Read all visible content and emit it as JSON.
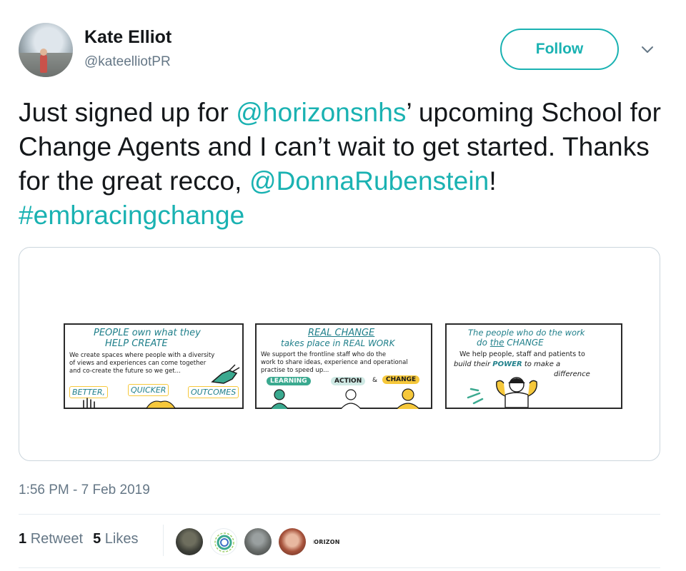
{
  "user": {
    "display_name": "Kate Elliot",
    "handle": "@kateelliotPR"
  },
  "actions": {
    "follow_label": "Follow",
    "menu_icon": "chevron-down-icon"
  },
  "tweet": {
    "text_1": "Just signed up for ",
    "mention_1": "@horizonsnhs",
    "text_2": "’ upcoming School for Change Agents and I can’t wait to get started. Thanks for the great recco, ",
    "mention_2": "@DonnaRubenstein",
    "text_3": "! ",
    "hashtag": "#embracingchange"
  },
  "media": {
    "panels": [
      {
        "title_1": "PEOPLE own what they",
        "title_2": "HELP CREATE",
        "body_1": "We create spaces where people with a diversity",
        "body_2": "of views and experiences can come together",
        "body_3": "and co-create the future so we get...",
        "tag_1": "BETTER,",
        "tag_2": "QUICKER",
        "tag_3": "OUTCOMES"
      },
      {
        "title_1": "REAL CHANGE",
        "title_2": "takes place in REAL WORK",
        "body_1": "We support the frontline staff who do the",
        "body_2": "work to share ideas, experience and operational",
        "body_3": "practise to speed up...",
        "tag_1": "LEARNING",
        "tag_2": "ACTION",
        "tag_amp": "&",
        "tag_3": "CHANGE"
      },
      {
        "title_1": "The people who do the work",
        "title_2a": "do ",
        "title_2b": "the",
        "title_2c": " CHANGE",
        "body_1": "We help people, staff and patients to",
        "body_2a": "build their ",
        "body_2b": "POWER",
        "body_2c": " to make a",
        "body_3": "difference"
      }
    ]
  },
  "footer": {
    "timestamp": "1:56 PM - 7 Feb 2019",
    "retweet_count": "1",
    "retweet_label": "Retweet",
    "like_count": "5",
    "like_label": "Likes",
    "liker_badge_text": "HORIZONS"
  },
  "colors": {
    "accent": "#1ab2b2",
    "secondary_text": "#657786",
    "border": "#ccd6dd"
  }
}
